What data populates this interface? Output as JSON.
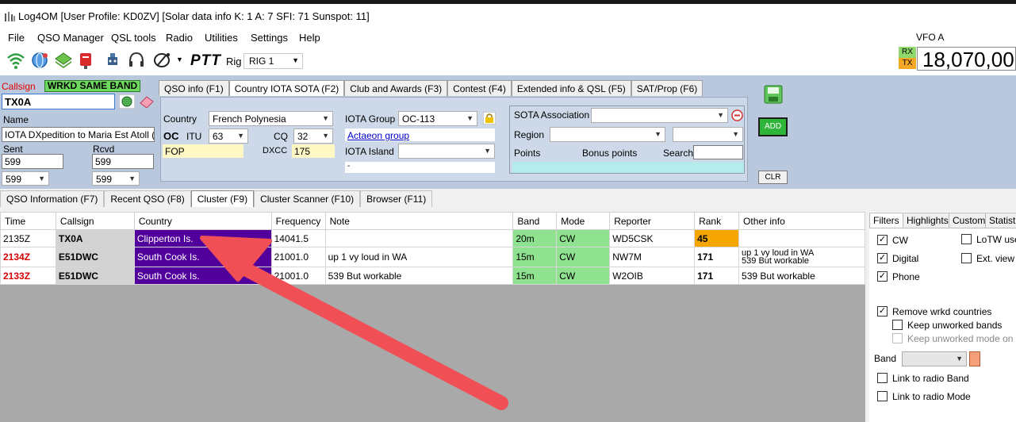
{
  "window": {
    "title": "Log4OM [User Profile: KD0ZV] [Solar data info K: 1 A: 7 SFI: 71 Sunspot: 11]"
  },
  "menu": [
    "File",
    "QSO Manager",
    "QSL tools",
    "Radio",
    "Utilities",
    "Settings",
    "Help"
  ],
  "toolbar": {
    "ptt": "PTT",
    "rig_label": "Rig",
    "rig_value": "RIG 1",
    "vfo_label": "VFO A",
    "rx": "RX",
    "tx": "TX",
    "frequency": "18,070,00"
  },
  "entry": {
    "callsign_label": "Callsign",
    "callsign_value": "TX0A",
    "wrkd_badge": "WRKD SAME BAND",
    "name_label": "Name",
    "name_value": "IOTA DXpedition to Maria Est Atoll (OC-",
    "sent_label": "Sent",
    "rcvd_label": "Rcvd",
    "sent_value": "599",
    "rcvd_value": "599",
    "sent_select": "599",
    "rcvd_select": "599"
  },
  "qso_tabs": [
    "QSO info (F1)",
    "Country IOTA SOTA (F2)",
    "Club and Awards (F3)",
    "Contest (F4)",
    "Extended info & QSL (F5)",
    "SAT/Prop (F6)"
  ],
  "country_panel": {
    "country_label": "Country",
    "country_value": "French Polynesia",
    "continent": "OC",
    "itu_label": "ITU",
    "itu_value": "63",
    "cq_label": "CQ",
    "cq_value": "32",
    "prefix": "FOP",
    "dxcc_label": "DXCC",
    "dxcc_value": "175",
    "iota_group_label": "IOTA Group",
    "iota_group_value": "OC-113",
    "iota_link": "Actaeon group",
    "iota_island_label": "IOTA Island",
    "iota_island_value": "-",
    "sota_label": "SOTA Association",
    "region_label": "Region",
    "points_label": "Points",
    "bonus_label": "Bonus points",
    "search_label": "Search"
  },
  "buttons": {
    "add": "ADD",
    "clr": "CLR"
  },
  "lower_tabs": [
    "QSO Information (F7)",
    "Recent QSO (F8)",
    "Cluster (F9)",
    "Cluster Scanner (F10)",
    "Browser (F11)"
  ],
  "cluster": {
    "columns": [
      "Time",
      "Callsign",
      "Country",
      "Frequency",
      "Note",
      "Band",
      "Mode",
      "Reporter",
      "Rank",
      "Other info"
    ],
    "rows": [
      {
        "time": "2135Z",
        "callsign": "TX0A",
        "country": "Clipperton Is.",
        "frequency": "14041.5",
        "note": "",
        "band": "20m",
        "mode": "CW",
        "reporter": "WD5CSK",
        "rank": "45",
        "other": ""
      },
      {
        "time": "2134Z",
        "callsign": "E51DWC",
        "country": "South Cook Is.",
        "frequency": "21001.0",
        "note": "up 1  vy loud in WA",
        "band": "15m",
        "mode": "CW",
        "reporter": "NW7M",
        "rank": "171",
        "other": "up 1  vy loud in WA",
        "other2": "539 But workable"
      },
      {
        "time": "2133Z",
        "callsign": "E51DWC",
        "country": "South Cook Is.",
        "frequency": "21001.0",
        "note": "539 But workable",
        "band": "15m",
        "mode": "CW",
        "reporter": "W2OIB",
        "rank": "171",
        "other": "539 But workable"
      }
    ]
  },
  "filters": {
    "tabs": [
      "Filters",
      "Highlights",
      "Custom",
      "Statisti"
    ],
    "cw": "CW",
    "digital": "Digital",
    "phone": "Phone",
    "lotw": "LoTW use",
    "ext_view": "Ext. view",
    "remove_wrkd": "Remove wrkd countries",
    "keep_unworked_bands": "Keep unworked bands",
    "keep_unworked_mode": "Keep unworked mode on bar",
    "band_label": "Band",
    "link_radio_band": "Link to radio Band",
    "link_radio_mode": "Link to radio Mode"
  },
  "colors": {
    "country_highlight": "#52009c",
    "band_mode": "#8fe28f",
    "rank_highlight": "#f5a600",
    "arrow": "#f04f55",
    "panel_bg": "#b9c8dc"
  }
}
